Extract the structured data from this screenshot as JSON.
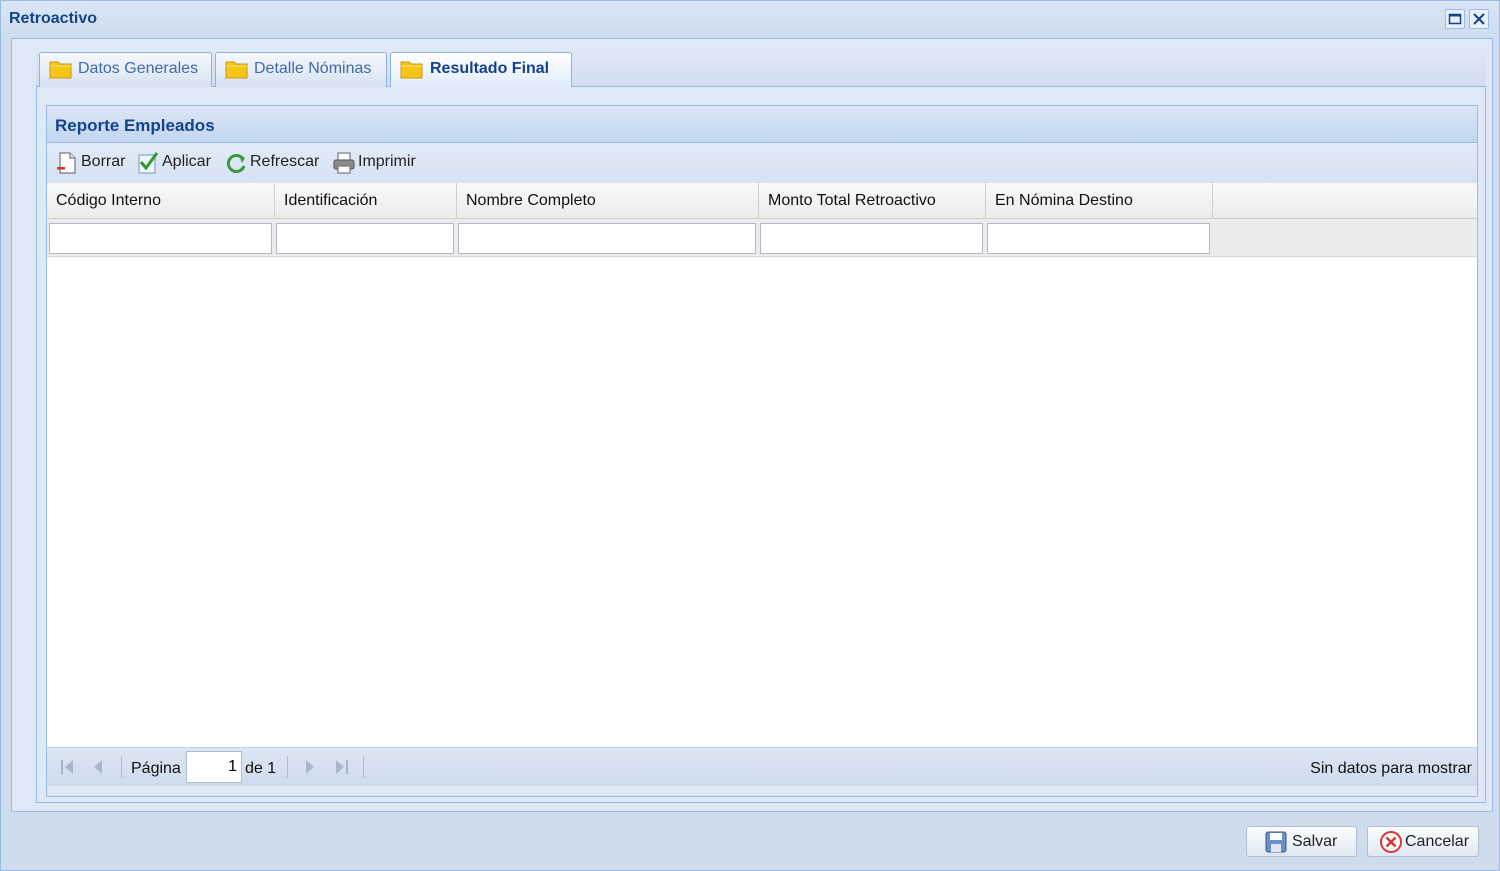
{
  "window": {
    "title": "Retroactivo"
  },
  "tabs": [
    {
      "label": "Datos Generales",
      "active": false
    },
    {
      "label": "Detalle Nóminas",
      "active": false
    },
    {
      "label": "Resultado Final",
      "active": true
    }
  ],
  "panel": {
    "title": "Reporte Empleados"
  },
  "toolbar": {
    "borrar": "Borrar",
    "aplicar": "Aplicar",
    "refrescar": "Refrescar",
    "imprimir": "Imprimir"
  },
  "grid": {
    "columns": [
      "Código Interno",
      "Identificación",
      "Nombre Completo",
      "Monto Total Retroactivo",
      "En Nómina Destino"
    ],
    "filters": [
      "",
      "",
      "",
      "",
      ""
    ],
    "rows": []
  },
  "pager": {
    "page_label": "Página",
    "page_value": "1",
    "of_label": "de 1",
    "status": "Sin datos para mostrar"
  },
  "footer": {
    "save_label": "Salvar",
    "cancel_label": "Cancelar"
  },
  "colors": {
    "title_text": "#15428b",
    "border": "#99bbe8",
    "panel_bg": "#dfe8f6"
  }
}
